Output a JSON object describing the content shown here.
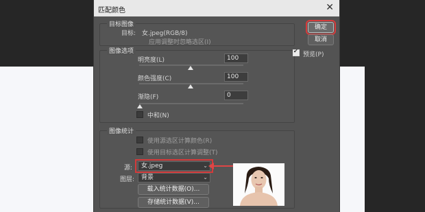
{
  "dialog": {
    "title": "匹配颜色",
    "close_glyph": "✕"
  },
  "target": {
    "group_label": "目标图像",
    "target_label": "目标:",
    "target_value": "女.jpeg(RGB/8)",
    "ignore_selection": "应用调整时忽略选区(I)"
  },
  "options": {
    "group_label": "图像选项",
    "luminance": {
      "label": "明亮度(L)",
      "value": "100"
    },
    "intensity": {
      "label": "颜色强度(C)",
      "value": "100"
    },
    "fade": {
      "label": "渐隐(F)",
      "value": "0"
    },
    "neutralize": "中和(N)"
  },
  "stats": {
    "group_label": "图像统计",
    "use_source_sel": "使用源选区计算颜色(R)",
    "use_target_sel": "使用目标选区计算调整(T)",
    "source_label": "源:",
    "source_value": "女.jpeg",
    "layer_label": "图层:",
    "layer_value": "背景",
    "load_btn": "载入统计数据(O)...",
    "save_btn": "存储统计数据(V)..."
  },
  "buttons": {
    "ok": "确定",
    "cancel": "取消"
  },
  "preview": {
    "label": "预览(P)",
    "checked": true
  },
  "sliders": {
    "luminance_level": 1.0,
    "intensity_level": 1.0,
    "fade_level": 0.0
  },
  "colors": {
    "annotation": "#d53a3a",
    "dialog_bg": "#535353"
  }
}
